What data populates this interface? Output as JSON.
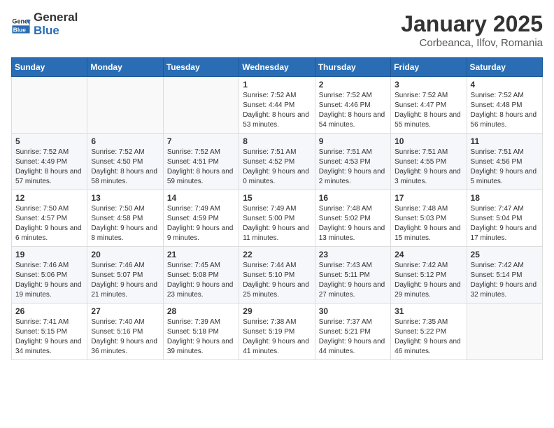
{
  "header": {
    "logo_general": "General",
    "logo_blue": "Blue",
    "month_title": "January 2025",
    "location": "Corbeanca, Ilfov, Romania"
  },
  "weekdays": [
    "Sunday",
    "Monday",
    "Tuesday",
    "Wednesday",
    "Thursday",
    "Friday",
    "Saturday"
  ],
  "weeks": [
    [
      {
        "day": "",
        "sunrise": "",
        "sunset": "",
        "daylight": ""
      },
      {
        "day": "",
        "sunrise": "",
        "sunset": "",
        "daylight": ""
      },
      {
        "day": "",
        "sunrise": "",
        "sunset": "",
        "daylight": ""
      },
      {
        "day": "1",
        "sunrise": "Sunrise: 7:52 AM",
        "sunset": "Sunset: 4:44 PM",
        "daylight": "Daylight: 8 hours and 53 minutes."
      },
      {
        "day": "2",
        "sunrise": "Sunrise: 7:52 AM",
        "sunset": "Sunset: 4:46 PM",
        "daylight": "Daylight: 8 hours and 54 minutes."
      },
      {
        "day": "3",
        "sunrise": "Sunrise: 7:52 AM",
        "sunset": "Sunset: 4:47 PM",
        "daylight": "Daylight: 8 hours and 55 minutes."
      },
      {
        "day": "4",
        "sunrise": "Sunrise: 7:52 AM",
        "sunset": "Sunset: 4:48 PM",
        "daylight": "Daylight: 8 hours and 56 minutes."
      }
    ],
    [
      {
        "day": "5",
        "sunrise": "Sunrise: 7:52 AM",
        "sunset": "Sunset: 4:49 PM",
        "daylight": "Daylight: 8 hours and 57 minutes."
      },
      {
        "day": "6",
        "sunrise": "Sunrise: 7:52 AM",
        "sunset": "Sunset: 4:50 PM",
        "daylight": "Daylight: 8 hours and 58 minutes."
      },
      {
        "day": "7",
        "sunrise": "Sunrise: 7:52 AM",
        "sunset": "Sunset: 4:51 PM",
        "daylight": "Daylight: 8 hours and 59 minutes."
      },
      {
        "day": "8",
        "sunrise": "Sunrise: 7:51 AM",
        "sunset": "Sunset: 4:52 PM",
        "daylight": "Daylight: 9 hours and 0 minutes."
      },
      {
        "day": "9",
        "sunrise": "Sunrise: 7:51 AM",
        "sunset": "Sunset: 4:53 PM",
        "daylight": "Daylight: 9 hours and 2 minutes."
      },
      {
        "day": "10",
        "sunrise": "Sunrise: 7:51 AM",
        "sunset": "Sunset: 4:55 PM",
        "daylight": "Daylight: 9 hours and 3 minutes."
      },
      {
        "day": "11",
        "sunrise": "Sunrise: 7:51 AM",
        "sunset": "Sunset: 4:56 PM",
        "daylight": "Daylight: 9 hours and 5 minutes."
      }
    ],
    [
      {
        "day": "12",
        "sunrise": "Sunrise: 7:50 AM",
        "sunset": "Sunset: 4:57 PM",
        "daylight": "Daylight: 9 hours and 6 minutes."
      },
      {
        "day": "13",
        "sunrise": "Sunrise: 7:50 AM",
        "sunset": "Sunset: 4:58 PM",
        "daylight": "Daylight: 9 hours and 8 minutes."
      },
      {
        "day": "14",
        "sunrise": "Sunrise: 7:49 AM",
        "sunset": "Sunset: 4:59 PM",
        "daylight": "Daylight: 9 hours and 9 minutes."
      },
      {
        "day": "15",
        "sunrise": "Sunrise: 7:49 AM",
        "sunset": "Sunset: 5:00 PM",
        "daylight": "Daylight: 9 hours and 11 minutes."
      },
      {
        "day": "16",
        "sunrise": "Sunrise: 7:48 AM",
        "sunset": "Sunset: 5:02 PM",
        "daylight": "Daylight: 9 hours and 13 minutes."
      },
      {
        "day": "17",
        "sunrise": "Sunrise: 7:48 AM",
        "sunset": "Sunset: 5:03 PM",
        "daylight": "Daylight: 9 hours and 15 minutes."
      },
      {
        "day": "18",
        "sunrise": "Sunrise: 7:47 AM",
        "sunset": "Sunset: 5:04 PM",
        "daylight": "Daylight: 9 hours and 17 minutes."
      }
    ],
    [
      {
        "day": "19",
        "sunrise": "Sunrise: 7:46 AM",
        "sunset": "Sunset: 5:06 PM",
        "daylight": "Daylight: 9 hours and 19 minutes."
      },
      {
        "day": "20",
        "sunrise": "Sunrise: 7:46 AM",
        "sunset": "Sunset: 5:07 PM",
        "daylight": "Daylight: 9 hours and 21 minutes."
      },
      {
        "day": "21",
        "sunrise": "Sunrise: 7:45 AM",
        "sunset": "Sunset: 5:08 PM",
        "daylight": "Daylight: 9 hours and 23 minutes."
      },
      {
        "day": "22",
        "sunrise": "Sunrise: 7:44 AM",
        "sunset": "Sunset: 5:10 PM",
        "daylight": "Daylight: 9 hours and 25 minutes."
      },
      {
        "day": "23",
        "sunrise": "Sunrise: 7:43 AM",
        "sunset": "Sunset: 5:11 PM",
        "daylight": "Daylight: 9 hours and 27 minutes."
      },
      {
        "day": "24",
        "sunrise": "Sunrise: 7:42 AM",
        "sunset": "Sunset: 5:12 PM",
        "daylight": "Daylight: 9 hours and 29 minutes."
      },
      {
        "day": "25",
        "sunrise": "Sunrise: 7:42 AM",
        "sunset": "Sunset: 5:14 PM",
        "daylight": "Daylight: 9 hours and 32 minutes."
      }
    ],
    [
      {
        "day": "26",
        "sunrise": "Sunrise: 7:41 AM",
        "sunset": "Sunset: 5:15 PM",
        "daylight": "Daylight: 9 hours and 34 minutes."
      },
      {
        "day": "27",
        "sunrise": "Sunrise: 7:40 AM",
        "sunset": "Sunset: 5:16 PM",
        "daylight": "Daylight: 9 hours and 36 minutes."
      },
      {
        "day": "28",
        "sunrise": "Sunrise: 7:39 AM",
        "sunset": "Sunset: 5:18 PM",
        "daylight": "Daylight: 9 hours and 39 minutes."
      },
      {
        "day": "29",
        "sunrise": "Sunrise: 7:38 AM",
        "sunset": "Sunset: 5:19 PM",
        "daylight": "Daylight: 9 hours and 41 minutes."
      },
      {
        "day": "30",
        "sunrise": "Sunrise: 7:37 AM",
        "sunset": "Sunset: 5:21 PM",
        "daylight": "Daylight: 9 hours and 44 minutes."
      },
      {
        "day": "31",
        "sunrise": "Sunrise: 7:35 AM",
        "sunset": "Sunset: 5:22 PM",
        "daylight": "Daylight: 9 hours and 46 minutes."
      },
      {
        "day": "",
        "sunrise": "",
        "sunset": "",
        "daylight": ""
      }
    ]
  ]
}
